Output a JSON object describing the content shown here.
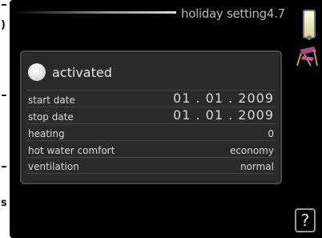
{
  "header": {
    "title": "holiday setting",
    "menu_number": "4.7"
  },
  "panel": {
    "activated_label": "activated",
    "rows": [
      {
        "label": "start date",
        "value": "01 . 01 . 2009"
      },
      {
        "label": "stop date",
        "value": "01 . 01 . 2009"
      },
      {
        "label": "heating",
        "value": "0"
      },
      {
        "label": "hot water comfort",
        "value": "economy"
      },
      {
        "label": "ventilation",
        "value": "normal"
      }
    ]
  },
  "help_label": "?",
  "icons": {
    "thermometer": "thermometer-icon",
    "deckchair": "deckchair-icon",
    "help": "help-icon"
  },
  "colors": {
    "screen_bg": "#000000",
    "panel_bg": "#2a2a2a",
    "text": "#d8d8d8"
  }
}
